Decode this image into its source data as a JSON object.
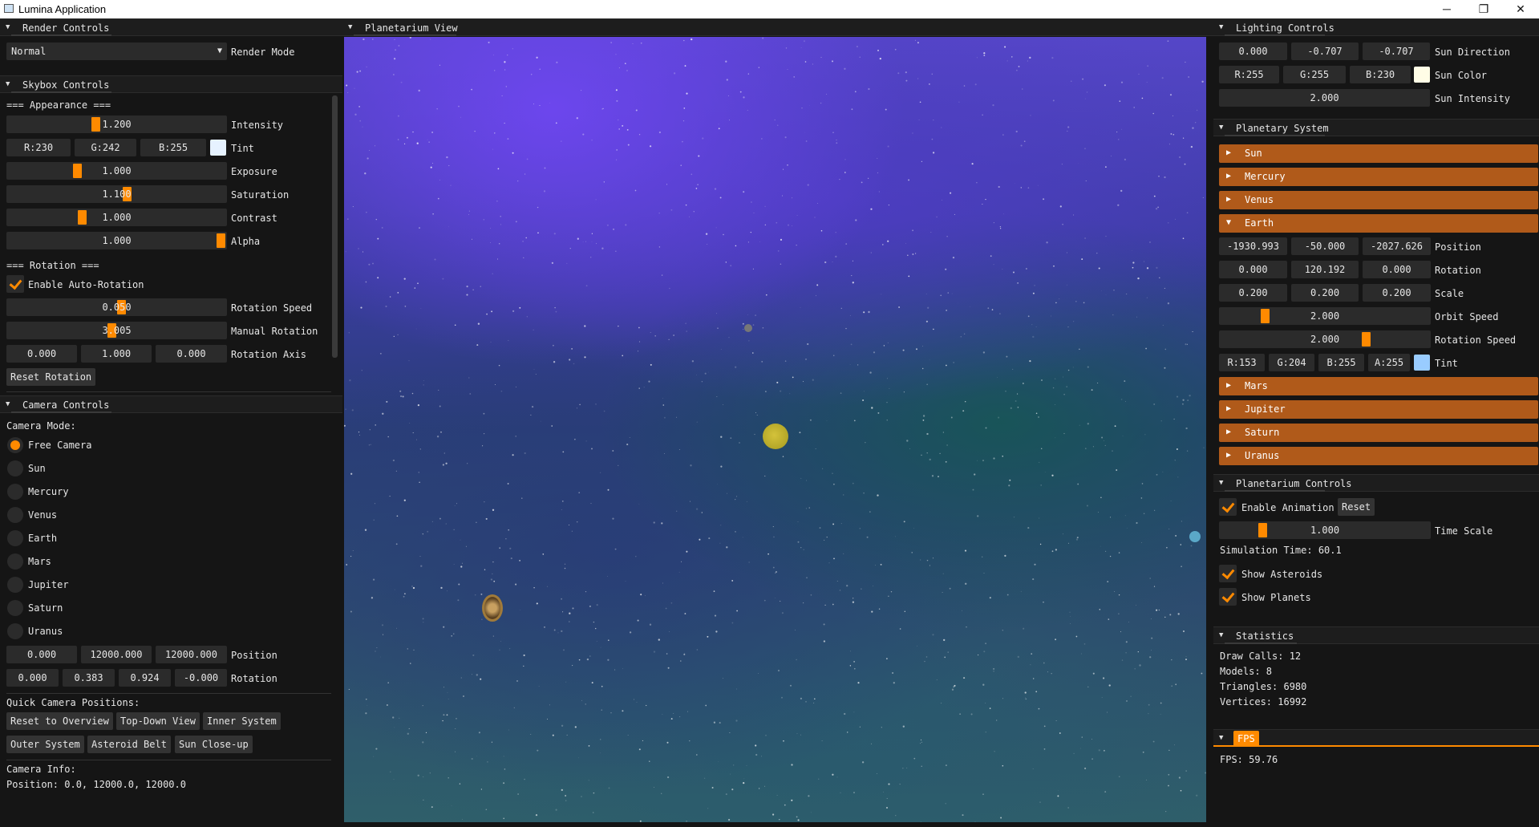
{
  "window": {
    "title": "Lumina Application",
    "minimize": "─",
    "maximize": "❐",
    "close": "✕"
  },
  "render": {
    "title": "Render Controls",
    "mode_value": "Normal",
    "mode_label": "Render Mode"
  },
  "skybox": {
    "title": "Skybox Controls",
    "appearance_header": "=== Appearance ===",
    "intensity": {
      "value": "1.200",
      "label": "Intensity",
      "level": 0.42
    },
    "tint": {
      "r": "R:230",
      "g": "G:242",
      "b": "B:255",
      "label": "Tint",
      "color": "#e6f2ff"
    },
    "exposure": {
      "value": "1.000",
      "label": "Exposure",
      "level": 0.33
    },
    "saturation": {
      "value": "1.100",
      "label": "Saturation",
      "level": 0.55
    },
    "contrast": {
      "value": "1.000",
      "label": "Contrast",
      "level": 0.35
    },
    "alpha": {
      "value": "1.000",
      "label": "Alpha",
      "level": 1.0
    },
    "rotation_header": "=== Rotation ===",
    "auto_rotation_label": "Enable Auto-Rotation",
    "rotation_speed": {
      "value": "0.050",
      "label": "Rotation Speed",
      "level": 0.53
    },
    "manual_rotation": {
      "value": "3.005",
      "label": "Manual Rotation",
      "level": 0.48
    },
    "rotation_axis": {
      "x": "0.000",
      "y": "1.000",
      "z": "0.000",
      "label": "Rotation Axis"
    },
    "reset_label": "Reset Rotation"
  },
  "camera": {
    "title": "Camera Controls",
    "mode_label": "Camera Mode:",
    "modes": [
      "Free Camera",
      "Sun",
      "Mercury",
      "Venus",
      "Earth",
      "Mars",
      "Jupiter",
      "Saturn",
      "Uranus"
    ],
    "position": {
      "x": "0.000",
      "y": "12000.000",
      "z": "12000.000",
      "label": "Position"
    },
    "rotation": {
      "x": "0.000",
      "y": "0.383",
      "z": "0.924",
      "w": "-0.000",
      "label": "Rotation"
    },
    "quick_label": "Quick Camera Positions:",
    "quick": [
      "Reset to Overview",
      "Top-Down View",
      "Inner System",
      "Outer System",
      "Asteroid Belt",
      "Sun Close-up"
    ],
    "info_label": "Camera Info:",
    "info_position": "Position: 0.0, 12000.0, 12000.0"
  },
  "view": {
    "title": "Planetarium View"
  },
  "lighting": {
    "title": "Lighting Controls",
    "sun_direction": {
      "x": "0.000",
      "y": "-0.707",
      "z": "-0.707",
      "label": "Sun Direction"
    },
    "sun_color": {
      "r": "R:255",
      "g": "G:255",
      "b": "B:230",
      "label": "Sun Color",
      "color": "#fffde6"
    },
    "sun_intensity": {
      "value": "2.000",
      "label": "Sun Intensity"
    }
  },
  "planetary": {
    "title": "Planetary System",
    "collapsed_top": [
      "Sun",
      "Mercury",
      "Venus"
    ],
    "expanded": "Earth",
    "earth": {
      "position": {
        "x": "-1930.993",
        "y": "-50.000",
        "z": "-2027.626",
        "label": "Position"
      },
      "rotation": {
        "x": "0.000",
        "y": "120.192",
        "z": "0.000",
        "label": "Rotation"
      },
      "scale": {
        "x": "0.200",
        "y": "0.200",
        "z": "0.200",
        "label": "Scale"
      },
      "orbit_speed": {
        "value": "2.000",
        "label": "Orbit Speed",
        "level": 0.2
      },
      "rotation_speed": {
        "value": "2.000",
        "label": "Rotation Speed",
        "level": 0.68
      },
      "tint": {
        "r": "R:153",
        "g": "G:204",
        "b": "B:255",
        "a": "A:255",
        "label": "Tint",
        "color": "#99ccff"
      }
    },
    "collapsed_bottom": [
      "Mars",
      "Jupiter",
      "Saturn",
      "Uranus"
    ]
  },
  "planetarium": {
    "title": "Planetarium Controls",
    "animation_label": "Enable Animation",
    "reset_label": "Reset",
    "time_scale": {
      "value": "1.000",
      "label": "Time Scale",
      "level": 0.2
    },
    "sim_time": "Simulation Time: 60.1",
    "asteroids_label": "Show Asteroids",
    "planets_label": "Show Planets"
  },
  "statistics": {
    "title": "Statistics",
    "draw_calls": "Draw Calls: 12",
    "models": "Models: 8",
    "triangles": "Triangles: 6980",
    "vertices": "Vertices: 16992"
  },
  "fps": {
    "title": "FPS",
    "value": "FPS: 59.76"
  }
}
